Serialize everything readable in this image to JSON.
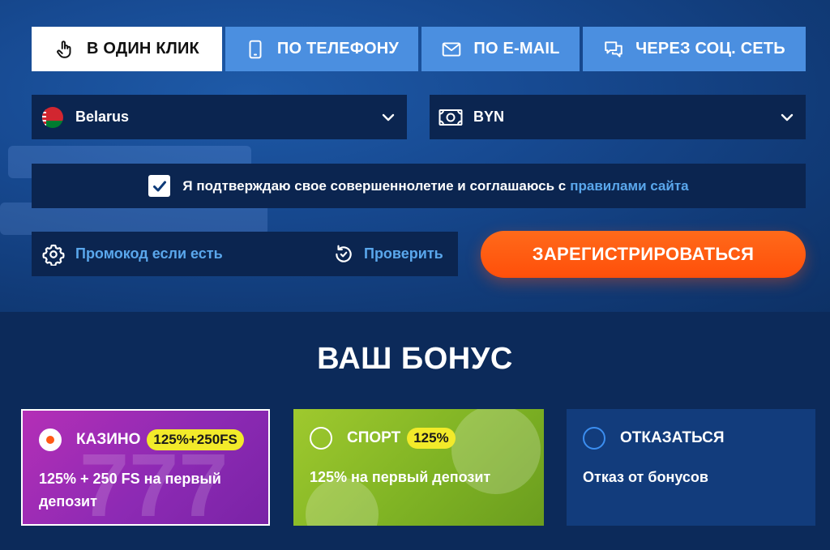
{
  "tabs": [
    {
      "label": "В ОДИН КЛИК",
      "icon": "hand-pointer-icon",
      "active": true
    },
    {
      "label": "ПО ТЕЛЕФОНУ",
      "icon": "phone-icon",
      "active": false
    },
    {
      "label": "ПО E-MAIL",
      "icon": "envelope-icon",
      "active": false
    },
    {
      "label": "ЧЕРЕЗ СОЦ. СЕТЬ",
      "icon": "chat-icon",
      "active": false
    }
  ],
  "country": {
    "value": "Belarus",
    "icon": "belarus-flag-icon"
  },
  "currency": {
    "value": "BYN",
    "icon": "money-icon"
  },
  "consent": {
    "checked": true,
    "text": "Я подтверждаю свое совершеннолетие и соглашаюсь с",
    "link_text": "правилами сайта"
  },
  "promo": {
    "placeholder": "Промокод если есть",
    "verify_label": "Проверить"
  },
  "register_label": "ЗАРЕГИСТРИРОВАТЬСЯ",
  "bonus": {
    "title": "ВАШ БОНУС",
    "options": [
      {
        "name": "КАЗИНО",
        "badge": "125%+250FS",
        "desc": "125% + 250 FS на первый депозит",
        "selected": true
      },
      {
        "name": "СПОРТ",
        "badge": "125%",
        "desc": "125% на первый депозит",
        "selected": false
      },
      {
        "name": "ОТКАЗАТЬСЯ",
        "badge": "",
        "desc": "Отказ от бонусов",
        "selected": false
      }
    ]
  },
  "colors": {
    "accent_blue": "#4b8fe0",
    "link_blue": "#5aa7ec",
    "register_orange": "#ff5a14",
    "badge_yellow": "#f2ea2a"
  }
}
